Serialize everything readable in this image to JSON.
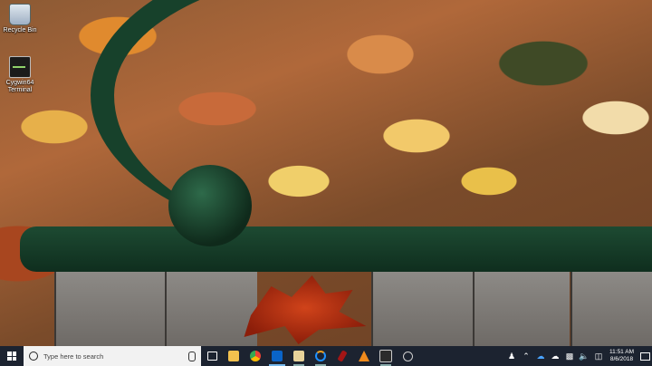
{
  "desktop": {
    "icons": [
      {
        "label": "Recycle Bin",
        "icon": "recycle-bin-icon"
      },
      {
        "label": "Cygwin64 Terminal",
        "icon": "terminal-icon"
      }
    ]
  },
  "taskbar": {
    "search_placeholder": "Type here to search",
    "pinned": [
      {
        "name": "task-view",
        "icon": "task-view-icon"
      },
      {
        "name": "file-explorer",
        "icon": "folder-icon",
        "color": "#f2c14e"
      },
      {
        "name": "chrome",
        "icon": "chrome-icon",
        "color": "#e94335"
      },
      {
        "name": "outlook",
        "icon": "outlook-icon",
        "color": "#0a64c8"
      },
      {
        "name": "paint",
        "icon": "paint-icon",
        "color": "#e8d39a"
      },
      {
        "name": "app-spinner",
        "icon": "circular-app-icon",
        "color": "#1e90ff"
      },
      {
        "name": "app-red",
        "icon": "red-app-icon",
        "color": "#a31515"
      },
      {
        "name": "vlc",
        "icon": "vlc-icon",
        "color": "#f08a1c"
      },
      {
        "name": "terminal",
        "icon": "terminal-icon",
        "color": "#2b2b2b"
      },
      {
        "name": "app-dial",
        "icon": "dial-icon",
        "color": "#cfcfcf"
      }
    ]
  },
  "tray": {
    "time": "11:51 AM",
    "date": "8/6/2018"
  }
}
